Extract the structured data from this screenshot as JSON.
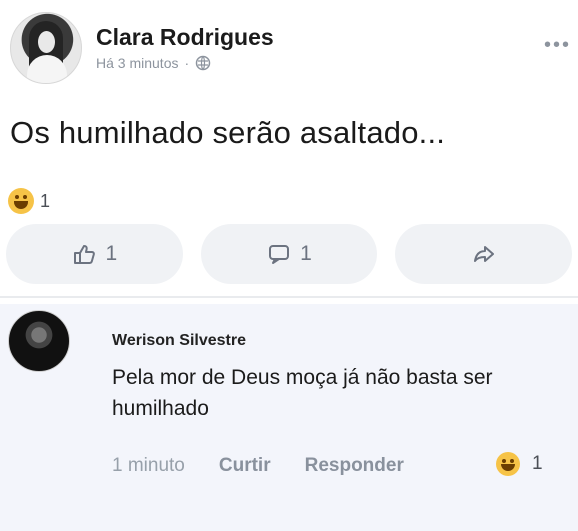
{
  "post": {
    "author": "Clara Rodrigues",
    "time": "Há 3 minutos",
    "separator": "·",
    "text": "Os humilhado serão asaltado...",
    "reaction_count": "1",
    "like_count": "1",
    "comment_count": "1",
    "colors": {
      "accent": "#6c7380",
      "action_background": "#f0f2f5",
      "comment_background": "#f3f5fb"
    },
    "icons": [
      "globe-icon",
      "laugh-emoji-icon",
      "thumbs-up-icon",
      "comment-bubble-icon",
      "share-arrow-icon",
      "more-options-icon"
    ]
  },
  "comment": {
    "author": "Werison Silvestre",
    "text": "Pela mor de Deus moça já não basta ser humilhado",
    "time": "1 minuto",
    "like_label": "Curtir",
    "reply_label": "Responder",
    "reaction_count": "1"
  }
}
